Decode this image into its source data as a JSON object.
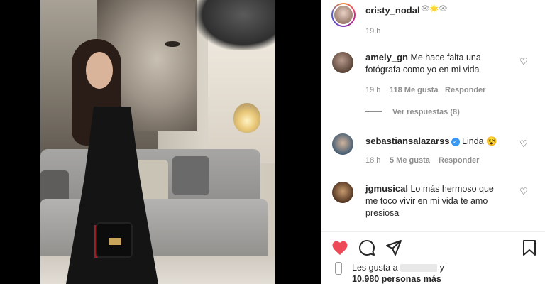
{
  "post": {
    "author": {
      "username": "cristy_nodal",
      "badges": "👁🌟👁",
      "time": "19 h"
    },
    "comments": [
      {
        "username": "amely_gn",
        "text_line1": "Me hace falta una",
        "text_line2": "fotógrafa como yo en mi vida",
        "time": "19 h",
        "likes": "118 Me gusta",
        "reply": "Responder",
        "view_replies": "Ver respuestas (8)"
      },
      {
        "username": "sebastiansalazarss",
        "verified": true,
        "text": "Linda 😵",
        "time": "18 h",
        "likes": "5 Me gusta",
        "reply": "Responder"
      },
      {
        "username": "jgmusical",
        "text_line1": "Lo más hermoso que",
        "text_line2": "me toco vivir en mi vida te amo",
        "text_line3": "presiosa"
      }
    ],
    "likes_summary": {
      "prefix": "Les gusta a",
      "suffix": "y",
      "count_text": "10.980 personas más"
    }
  },
  "icons": {
    "like": "heart-icon",
    "comment": "comment-icon",
    "share": "share-icon",
    "save": "bookmark-icon"
  },
  "colors": {
    "like_red": "#ed4956",
    "text": "#262626",
    "muted": "#8e8e8e",
    "verified_blue": "#3897f0"
  }
}
